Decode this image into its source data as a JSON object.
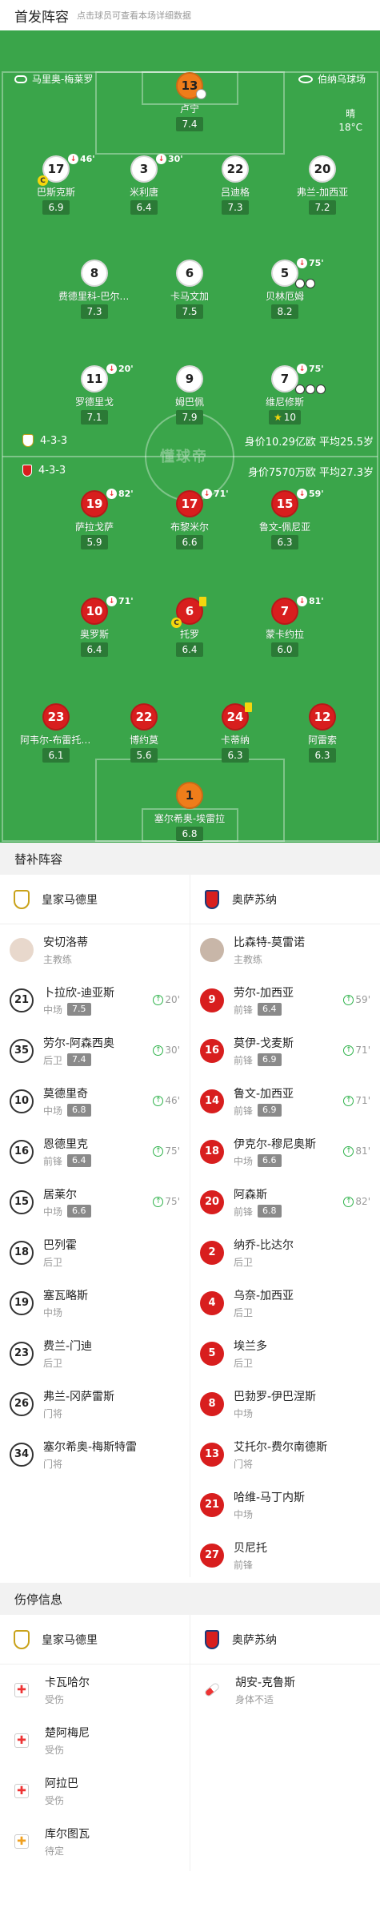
{
  "header": {
    "title": "首发阵容",
    "subtitle": "点击球员可查看本场详细数据"
  },
  "venue": {
    "referee": "马里奥-梅莱罗",
    "stadium": "伯纳乌球场"
  },
  "weather": {
    "condition": "晴",
    "temp": "18°C"
  },
  "watermark": "懂球帝",
  "home_team": {
    "formation": "4-3-3",
    "value": "身价10.29亿欧 平均25.5岁",
    "players": [
      {
        "num": "13",
        "name": "卢宁",
        "rating": "7.4",
        "sub": "",
        "role": "gk"
      },
      {
        "num": "17",
        "name": "巴斯克斯",
        "rating": "6.9",
        "sub": "46'",
        "captain": "C"
      },
      {
        "num": "3",
        "name": "米利唐",
        "rating": "6.4",
        "sub": "30'"
      },
      {
        "num": "22",
        "name": "吕迪格",
        "rating": "7.3",
        "sub": ""
      },
      {
        "num": "20",
        "name": "弗兰-加西亚",
        "rating": "7.2",
        "sub": ""
      },
      {
        "num": "8",
        "name": "费德里科-巴尔韦德",
        "rating": "7.3",
        "sub": ""
      },
      {
        "num": "6",
        "name": "卡马文加",
        "rating": "7.5",
        "sub": ""
      },
      {
        "num": "5",
        "name": "贝林厄姆",
        "rating": "8.2",
        "sub": "75'"
      },
      {
        "num": "11",
        "name": "罗德里戈",
        "rating": "7.1",
        "sub": "20'"
      },
      {
        "num": "9",
        "name": "姆巴佩",
        "rating": "7.9",
        "sub": ""
      },
      {
        "num": "7",
        "name": "维尼修斯",
        "rating": "10",
        "sub": "75'"
      }
    ]
  },
  "away_team": {
    "formation": "4-3-3",
    "value": "身价7570万欧 平均27.3岁",
    "players": [
      {
        "num": "19",
        "name": "萨拉戈萨",
        "rating": "5.9",
        "sub": "82'"
      },
      {
        "num": "17",
        "name": "布黎米尔",
        "rating": "6.6",
        "sub": "71'"
      },
      {
        "num": "15",
        "name": "鲁文-佩尼亚",
        "rating": "6.3",
        "sub": "59'"
      },
      {
        "num": "10",
        "name": "奥罗斯",
        "rating": "6.4",
        "sub": "71'"
      },
      {
        "num": "6",
        "name": "托罗",
        "rating": "6.4",
        "sub": "",
        "captain": "C"
      },
      {
        "num": "7",
        "name": "蒙卡约拉",
        "rating": "6.0",
        "sub": "81'"
      },
      {
        "num": "23",
        "name": "阿韦尔-布雷托内斯",
        "rating": "6.1",
        "sub": ""
      },
      {
        "num": "22",
        "name": "博约莫",
        "rating": "5.6",
        "sub": ""
      },
      {
        "num": "24",
        "name": "卡蒂纳",
        "rating": "6.3",
        "sub": ""
      },
      {
        "num": "12",
        "name": "阿雷索",
        "rating": "6.3",
        "sub": ""
      },
      {
        "num": "1",
        "name": "塞尔希奥-埃雷拉",
        "rating": "6.8",
        "sub": "",
        "role": "gk"
      }
    ]
  },
  "subs": {
    "title": "替补阵容",
    "home_name": "皇家马德里",
    "away_name": "奥萨苏纳",
    "home_coach": {
      "name": "安切洛蒂",
      "role": "主教练"
    },
    "away_coach": {
      "name": "比森特-莫雷诺",
      "role": "主教练"
    },
    "home": [
      {
        "num": "21",
        "name": "卜拉欣-迪亚斯",
        "pos": "中场",
        "rating": "7.5",
        "min": "20'"
      },
      {
        "num": "35",
        "name": "劳尔-阿森西奥",
        "pos": "后卫",
        "rating": "7.4",
        "min": "30'"
      },
      {
        "num": "10",
        "name": "莫德里奇",
        "pos": "中场",
        "rating": "6.8",
        "min": "46'"
      },
      {
        "num": "16",
        "name": "恩德里克",
        "pos": "前锋",
        "rating": "6.4",
        "min": "75'"
      },
      {
        "num": "15",
        "name": "居莱尔",
        "pos": "中场",
        "rating": "6.6",
        "min": "75'"
      },
      {
        "num": "18",
        "name": "巴列霍",
        "pos": "后卫",
        "rating": "",
        "min": ""
      },
      {
        "num": "19",
        "name": "塞瓦略斯",
        "pos": "中场",
        "rating": "",
        "min": ""
      },
      {
        "num": "23",
        "name": "费兰-门迪",
        "pos": "后卫",
        "rating": "",
        "min": ""
      },
      {
        "num": "26",
        "name": "弗兰-冈萨雷斯",
        "pos": "门将",
        "rating": "",
        "min": ""
      },
      {
        "num": "34",
        "name": "塞尔希奥-梅斯特雷",
        "pos": "门将",
        "rating": "",
        "min": ""
      }
    ],
    "away": [
      {
        "num": "9",
        "name": "劳尔-加西亚",
        "pos": "前锋",
        "rating": "6.4",
        "min": "59'"
      },
      {
        "num": "16",
        "name": "莫伊-戈麦斯",
        "pos": "前锋",
        "rating": "6.9",
        "min": "71'"
      },
      {
        "num": "14",
        "name": "鲁文-加西亚",
        "pos": "前锋",
        "rating": "6.9",
        "min": "71'"
      },
      {
        "num": "18",
        "name": "伊克尔-穆尼奥斯",
        "pos": "中场",
        "rating": "6.6",
        "min": "81'"
      },
      {
        "num": "20",
        "name": "阿森斯",
        "pos": "前锋",
        "rating": "6.8",
        "min": "82'"
      },
      {
        "num": "2",
        "name": "纳乔-比达尔",
        "pos": "后卫",
        "rating": "",
        "min": ""
      },
      {
        "num": "4",
        "name": "乌奈-加西亚",
        "pos": "后卫",
        "rating": "",
        "min": ""
      },
      {
        "num": "5",
        "name": "埃兰多",
        "pos": "后卫",
        "rating": "",
        "min": ""
      },
      {
        "num": "8",
        "name": "巴勃罗-伊巴涅斯",
        "pos": "中场",
        "rating": "",
        "min": ""
      },
      {
        "num": "13",
        "name": "艾托尔-费尔南德斯",
        "pos": "门将",
        "rating": "",
        "min": ""
      },
      {
        "num": "21",
        "name": "哈维-马丁内斯",
        "pos": "中场",
        "rating": "",
        "min": ""
      },
      {
        "num": "27",
        "name": "贝尼托",
        "pos": "前锋",
        "rating": "",
        "min": ""
      }
    ]
  },
  "injuries": {
    "title": "伤停信息",
    "home_name": "皇家马德里",
    "away_name": "奥萨苏纳",
    "home": [
      {
        "name": "卡瓦哈尔",
        "status": "受伤",
        "icon": "medical-cross-icon"
      },
      {
        "name": "楚阿梅尼",
        "status": "受伤",
        "icon": "medical-cross-icon"
      },
      {
        "name": "阿拉巴",
        "status": "受伤",
        "icon": "medical-cross-icon"
      },
      {
        "name": "库尔图瓦",
        "status": "待定",
        "icon": "medical-cross-icon"
      }
    ],
    "away": [
      {
        "name": "胡安-克鲁斯",
        "status": "身体不适",
        "icon": "pill-icon"
      }
    ]
  },
  "colors": {
    "pitch": "#3aa54a",
    "away": "#d81e1e",
    "gk": "#ef7d1a",
    "rating_bg": "#2b7a36"
  }
}
